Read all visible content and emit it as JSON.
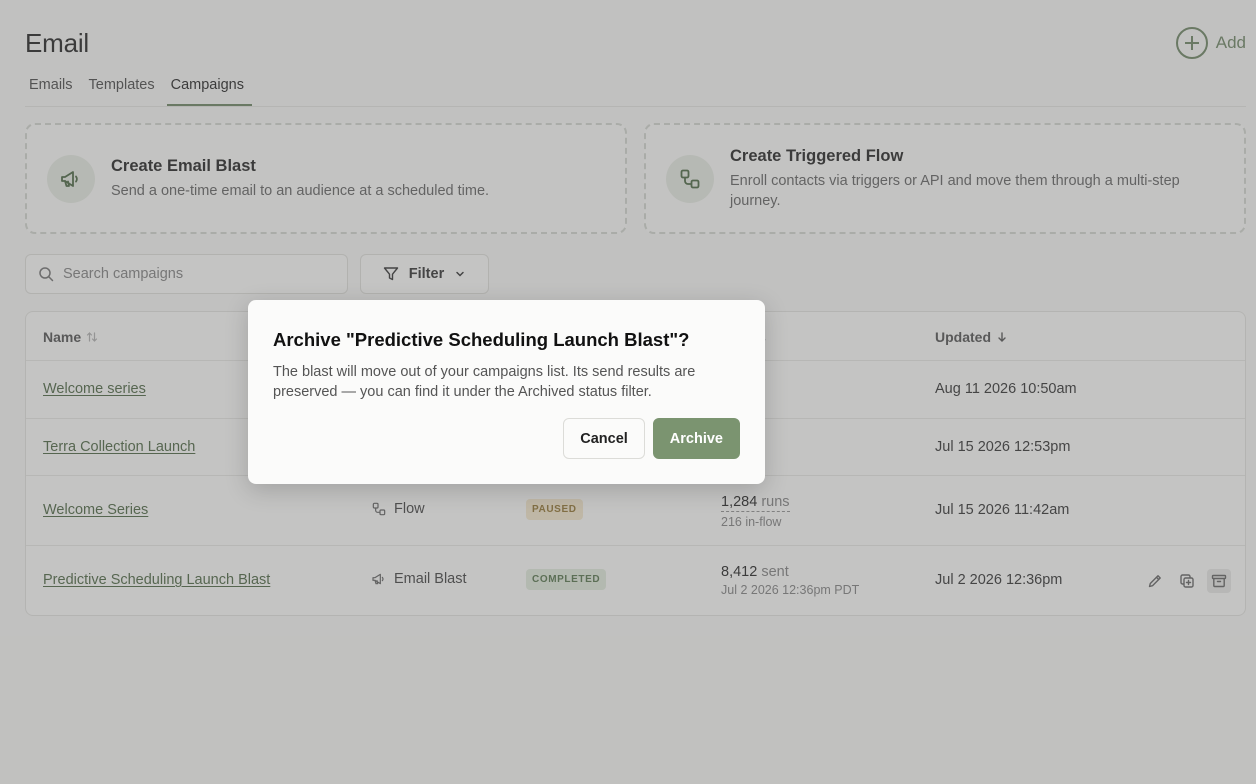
{
  "header": {
    "title": "Email",
    "add_label": "Add"
  },
  "tabs": [
    {
      "label": "Emails"
    },
    {
      "label": "Templates"
    },
    {
      "label": "Campaigns"
    }
  ],
  "cards": [
    {
      "title": "Create Email Blast",
      "description": "Send a one-time email to an audience at a scheduled time."
    },
    {
      "title": "Create Triggered Flow",
      "description": "Enroll contacts via triggers or API and move them through a multi-step journey."
    }
  ],
  "search": {
    "placeholder": "Search campaigns",
    "value": ""
  },
  "filter": {
    "label": "Filter"
  },
  "table": {
    "headers": {
      "name": "Name",
      "metrics_fragment": "s",
      "updated": "Updated"
    },
    "rows": [
      {
        "name": "Welcome series",
        "updated": "Aug 11 2026 10:50am"
      },
      {
        "name": "Terra Collection Launch",
        "updated": "Jul 15 2026 12:53pm"
      },
      {
        "name": "Welcome Series",
        "type": "Flow",
        "status": "PAUSED",
        "metric_value": "1,284",
        "metric_unit": "runs",
        "metric_sub": "216 in-flow",
        "updated": "Jul 15 2026 11:42am"
      },
      {
        "name": "Predictive Scheduling Launch Blast",
        "type": "Email Blast",
        "status": "COMPLETED",
        "metric_value": "8,412",
        "metric_unit": "sent",
        "metric_sub": "Jul 2 2026 12:36pm PDT",
        "updated": "Jul 2 2026 12:36pm"
      }
    ]
  },
  "modal": {
    "title": "Archive \"Predictive Scheduling Launch Blast\"?",
    "body": "The blast will move out of your campaigns list. Its send results are preserved — you can find it under the Archived status filter.",
    "cancel_label": "Cancel",
    "confirm_label": "Archive"
  },
  "colors": {
    "accent": "#617a56",
    "primary_button": "#7b9470",
    "paused_badge": "#f3e6c8",
    "completed_badge": "#dfe9d9"
  }
}
